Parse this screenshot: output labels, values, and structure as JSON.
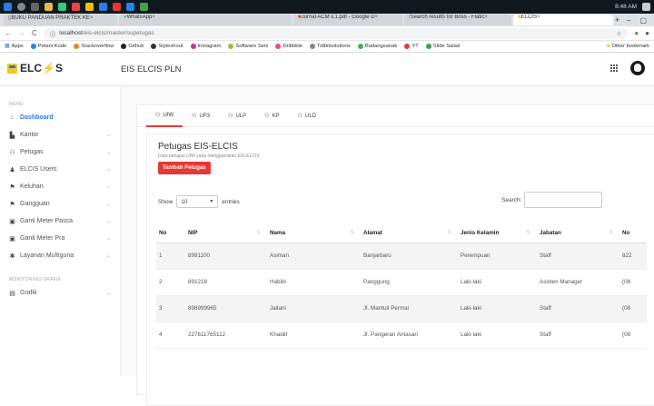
{
  "browser": {
    "tabs": [
      {
        "label": "BUKU PANDUAN PRAKTEK KE",
        "icon": "page-icon",
        "active": false
      },
      {
        "label": "WhatsApp",
        "icon": "whatsapp-icon",
        "active": false
      },
      {
        "label": "Jurnal ACM v.1.pdf - Google D",
        "icon": "gmail-icon",
        "active": false
      },
      {
        "label": "Search results for Boss - Flatic",
        "icon": "flaticon-icon",
        "active": false
      },
      {
        "label": "ELCIS",
        "icon": "elcis-icon",
        "active": true
      }
    ],
    "url_host": "localhost",
    "url_path": "/eis-elcis/master/supetugas",
    "time": "8:48 AM",
    "bookmarks": [
      "Apps",
      "Petani Kode",
      "Stackoverflow",
      "Github",
      "Styleshout",
      "Instagram",
      "Software Seni",
      "Dribbble",
      "Tidbitsolutions",
      "Badangsanak",
      "YT",
      "Slide Salad"
    ],
    "other_bookmarks": "Other bookmark"
  },
  "app": {
    "logo_text_a": "ELC",
    "logo_text_b": "S",
    "title": "EIS ELCIS PLN"
  },
  "sidebar": {
    "menu_label": "MENU",
    "items": [
      {
        "label": "Dashboard",
        "icon": "home-icon",
        "active": true
      },
      {
        "label": "Kantor",
        "icon": "building-icon"
      },
      {
        "label": "Petugas",
        "icon": "people-icon"
      },
      {
        "label": "ELCIS Users",
        "icon": "user-icon"
      },
      {
        "label": "Keluhan",
        "icon": "flag-icon"
      },
      {
        "label": "Gangguan",
        "icon": "flag-icon"
      },
      {
        "label": "Ganti Meter Pasca",
        "icon": "meter-icon"
      },
      {
        "label": "Ganti Meter Pra",
        "icon": "meter-icon"
      },
      {
        "label": "Layanan Multiguna",
        "icon": "service-icon"
      }
    ],
    "monitoring_label": "MONITORING GRAFIK",
    "monitoring_items": [
      {
        "label": "Grafik",
        "icon": "chart-icon"
      }
    ]
  },
  "subtabs": [
    "UIW",
    "UP3",
    "ULP",
    "KP",
    "ULD"
  ],
  "panel": {
    "title": "Petugas EIS-ELCIS",
    "subtitle": "Data petugas UIW yang menggunakan EIS-ELCIS",
    "add_button": "Tambah Petugas",
    "show_label": "Show",
    "show_value": "10",
    "entries_label": "entries",
    "search_label": "Search:"
  },
  "table": {
    "headers": [
      "No",
      "NIP",
      "Nama",
      "Alamat",
      "Jenis Kelamin",
      "Jabatan",
      "No"
    ],
    "rows": [
      [
        "1",
        "8991100",
        "Asiman",
        "Banjarbaru",
        "Perempuan",
        "Staff",
        "822"
      ],
      [
        "2",
        "891218",
        "Habibi",
        "Panggung",
        "Laki-laki",
        "Asisten Manager",
        "(08"
      ],
      [
        "3",
        "898999965",
        "Jailani",
        "Jl. Mantuil Permai",
        "Laki-laki",
        "Staff",
        "(08"
      ],
      [
        "4",
        "227611765112",
        "Khaidir",
        "Jl. Pangeran Antasari",
        "Laki-laki",
        "Staff",
        "(08"
      ]
    ]
  }
}
